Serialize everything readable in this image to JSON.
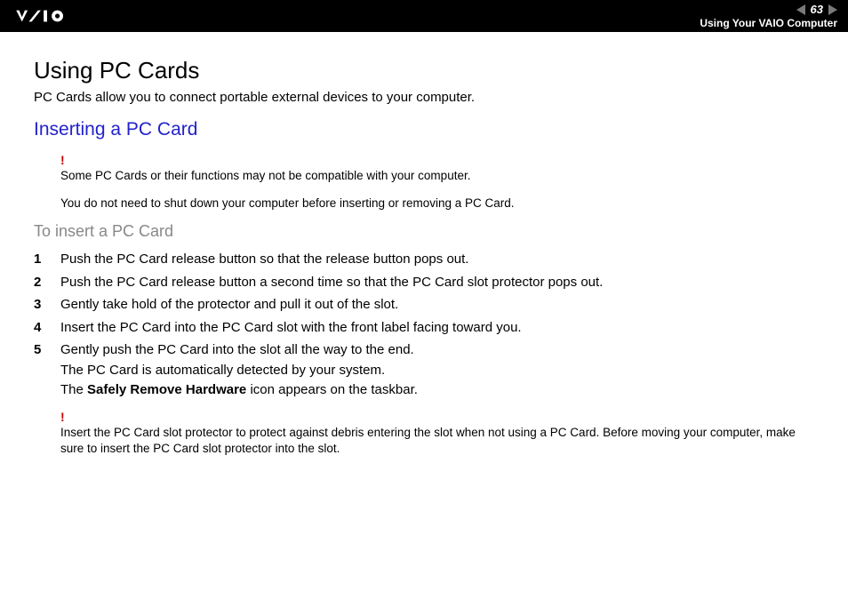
{
  "header": {
    "page_number": "63",
    "subtitle": "Using Your VAIO Computer"
  },
  "main": {
    "title": "Using PC Cards",
    "intro": "PC Cards allow you to connect portable external devices to your computer.",
    "section_title": "Inserting a PC Card",
    "warning1": "Some PC Cards or their functions may not be compatible with your computer.",
    "note1": "You do not need to shut down your computer before inserting or removing a PC Card.",
    "procedure_title": "To insert a PC Card",
    "steps": [
      "Push the PC Card release button so that the release button pops out.",
      "Push the PC Card release button a second time so that the PC Card slot protector pops out.",
      "Gently take hold of the protector and pull it out of the slot.",
      "Insert the PC Card into the PC Card slot with the front label facing toward you."
    ],
    "step5_line1": "Gently push the PC Card into the slot all the way to the end.",
    "step5_line2": "The PC Card is automatically detected by your system.",
    "step5_line3a": "The ",
    "step5_line3b": "Safely Remove Hardware",
    "step5_line3c": " icon appears on the taskbar.",
    "warning2": "Insert the PC Card slot protector to protect against debris entering the slot when not using a PC Card. Before moving your computer, make sure to insert the PC Card slot protector into the slot.",
    "step_numbers": [
      "1",
      "2",
      "3",
      "4",
      "5"
    ],
    "warn_mark": "!"
  }
}
